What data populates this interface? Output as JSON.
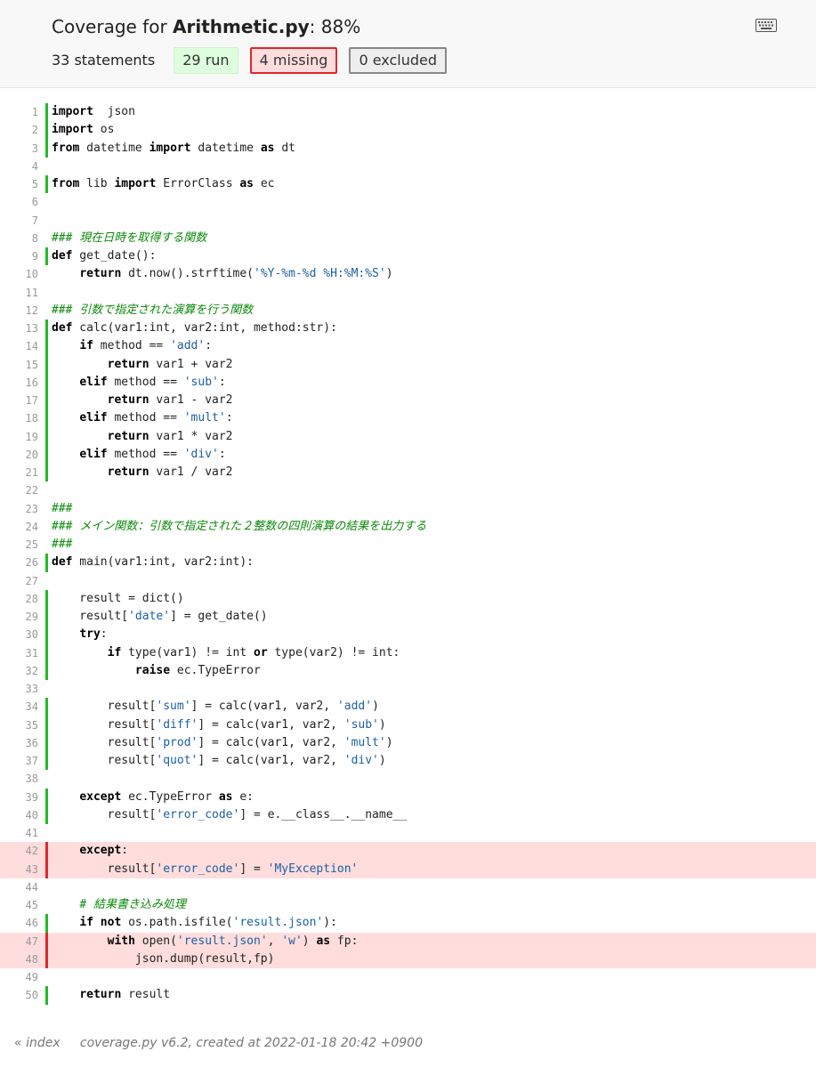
{
  "header": {
    "title_prefix": "Coverage for ",
    "file_name": "Arithmetic.py",
    "title_suffix": ": 88%",
    "statements": "33 statements",
    "run_label": "29 run",
    "missing_label": "4 missing",
    "excluded_label": "0 excluded",
    "keyboard_icon": "keyboard-icon"
  },
  "colors": {
    "run_bar": "#22bb22",
    "missing_bar": "#e0262d",
    "missing_bg": "#ffdddd",
    "run_badge_bg": "#ddffdd",
    "comment": "#0a8a0a",
    "string": "#1d5fa0"
  },
  "lines": [
    {
      "n": "1",
      "status": "run",
      "tokens": [
        [
          "k",
          "import"
        ],
        [
          "",
          "  json"
        ]
      ]
    },
    {
      "n": "2",
      "status": "run",
      "tokens": [
        [
          "k",
          "import"
        ],
        [
          "",
          " os"
        ]
      ]
    },
    {
      "n": "3",
      "status": "run",
      "tokens": [
        [
          "k",
          "from"
        ],
        [
          "",
          " datetime "
        ],
        [
          "k",
          "import"
        ],
        [
          "",
          " datetime "
        ],
        [
          "k",
          "as"
        ],
        [
          "",
          " dt"
        ]
      ]
    },
    {
      "n": "4",
      "status": "",
      "tokens": []
    },
    {
      "n": "5",
      "status": "run",
      "tokens": [
        [
          "k",
          "from"
        ],
        [
          "",
          " lib "
        ],
        [
          "k",
          "import"
        ],
        [
          "",
          " ErrorClass "
        ],
        [
          "k",
          "as"
        ],
        [
          "",
          " ec"
        ]
      ]
    },
    {
      "n": "6",
      "status": "",
      "tokens": []
    },
    {
      "n": "7",
      "status": "",
      "tokens": []
    },
    {
      "n": "8",
      "status": "",
      "tokens": [
        [
          "c",
          "### 現在日時を取得する関数"
        ]
      ]
    },
    {
      "n": "9",
      "status": "run",
      "tokens": [
        [
          "k",
          "def"
        ],
        [
          "",
          " get_date():"
        ]
      ]
    },
    {
      "n": "10",
      "status": "",
      "tokens": [
        [
          "",
          "    "
        ],
        [
          "k",
          "return"
        ],
        [
          "",
          " dt.now().strftime("
        ],
        [
          "s",
          "'%Y-%m-%d %H:%M:%S'"
        ],
        [
          "",
          ")"
        ]
      ]
    },
    {
      "n": "11",
      "status": "",
      "tokens": []
    },
    {
      "n": "12",
      "status": "",
      "tokens": [
        [
          "c",
          "### 引数で指定された演算を行う関数"
        ]
      ]
    },
    {
      "n": "13",
      "status": "run",
      "tokens": [
        [
          "k",
          "def"
        ],
        [
          "",
          " calc(var1:int, var2:int, method:str):"
        ]
      ]
    },
    {
      "n": "14",
      "status": "run",
      "tokens": [
        [
          "",
          "    "
        ],
        [
          "k",
          "if"
        ],
        [
          "",
          " method == "
        ],
        [
          "s",
          "'add'"
        ],
        [
          "",
          ":"
        ]
      ]
    },
    {
      "n": "15",
      "status": "run",
      "tokens": [
        [
          "",
          "        "
        ],
        [
          "k",
          "return"
        ],
        [
          "",
          " var1 + var2"
        ]
      ]
    },
    {
      "n": "16",
      "status": "run",
      "tokens": [
        [
          "",
          "    "
        ],
        [
          "k",
          "elif"
        ],
        [
          "",
          " method == "
        ],
        [
          "s",
          "'sub'"
        ],
        [
          "",
          ":"
        ]
      ]
    },
    {
      "n": "17",
      "status": "run",
      "tokens": [
        [
          "",
          "        "
        ],
        [
          "k",
          "return"
        ],
        [
          "",
          " var1 - var2"
        ]
      ]
    },
    {
      "n": "18",
      "status": "run",
      "tokens": [
        [
          "",
          "    "
        ],
        [
          "k",
          "elif"
        ],
        [
          "",
          " method == "
        ],
        [
          "s",
          "'mult'"
        ],
        [
          "",
          ":"
        ]
      ]
    },
    {
      "n": "19",
      "status": "run",
      "tokens": [
        [
          "",
          "        "
        ],
        [
          "k",
          "return"
        ],
        [
          "",
          " var1 * var2"
        ]
      ]
    },
    {
      "n": "20",
      "status": "run",
      "tokens": [
        [
          "",
          "    "
        ],
        [
          "k",
          "elif"
        ],
        [
          "",
          " method == "
        ],
        [
          "s",
          "'div'"
        ],
        [
          "",
          ":"
        ]
      ]
    },
    {
      "n": "21",
      "status": "run",
      "tokens": [
        [
          "",
          "        "
        ],
        [
          "k",
          "return"
        ],
        [
          "",
          " var1 / var2"
        ]
      ]
    },
    {
      "n": "22",
      "status": "",
      "tokens": []
    },
    {
      "n": "23",
      "status": "",
      "tokens": [
        [
          "c",
          "###"
        ]
      ]
    },
    {
      "n": "24",
      "status": "",
      "tokens": [
        [
          "c",
          "### メイン関数：引数で指定された２整数の四則演算の結果を出力する"
        ]
      ]
    },
    {
      "n": "25",
      "status": "",
      "tokens": [
        [
          "c",
          "###"
        ]
      ]
    },
    {
      "n": "26",
      "status": "run",
      "tokens": [
        [
          "k",
          "def"
        ],
        [
          "",
          " main(var1:int, var2:int):"
        ]
      ]
    },
    {
      "n": "27",
      "status": "",
      "tokens": []
    },
    {
      "n": "28",
      "status": "run",
      "tokens": [
        [
          "",
          "    result = dict()"
        ]
      ]
    },
    {
      "n": "29",
      "status": "run",
      "tokens": [
        [
          "",
          "    result["
        ],
        [
          "s",
          "'date'"
        ],
        [
          "",
          "] = get_date()"
        ]
      ]
    },
    {
      "n": "30",
      "status": "run",
      "tokens": [
        [
          "",
          "    "
        ],
        [
          "k",
          "try"
        ],
        [
          "",
          ":"
        ]
      ]
    },
    {
      "n": "31",
      "status": "run",
      "tokens": [
        [
          "",
          "        "
        ],
        [
          "k",
          "if"
        ],
        [
          "",
          " type(var1) != int "
        ],
        [
          "k",
          "or"
        ],
        [
          "",
          " type(var2) != int:"
        ]
      ]
    },
    {
      "n": "32",
      "status": "run",
      "tokens": [
        [
          "",
          "            "
        ],
        [
          "k",
          "raise"
        ],
        [
          "",
          " ec.TypeError"
        ]
      ]
    },
    {
      "n": "33",
      "status": "",
      "tokens": []
    },
    {
      "n": "34",
      "status": "run",
      "tokens": [
        [
          "",
          "        result["
        ],
        [
          "s",
          "'sum'"
        ],
        [
          "",
          "] = calc(var1, var2, "
        ],
        [
          "s",
          "'add'"
        ],
        [
          "",
          ")"
        ]
      ]
    },
    {
      "n": "35",
      "status": "run",
      "tokens": [
        [
          "",
          "        result["
        ],
        [
          "s",
          "'diff'"
        ],
        [
          "",
          "] = calc(var1, var2, "
        ],
        [
          "s",
          "'sub'"
        ],
        [
          "",
          ")"
        ]
      ]
    },
    {
      "n": "36",
      "status": "run",
      "tokens": [
        [
          "",
          "        result["
        ],
        [
          "s",
          "'prod'"
        ],
        [
          "",
          "] = calc(var1, var2, "
        ],
        [
          "s",
          "'mult'"
        ],
        [
          "",
          ")"
        ]
      ]
    },
    {
      "n": "37",
      "status": "run",
      "tokens": [
        [
          "",
          "        result["
        ],
        [
          "s",
          "'quot'"
        ],
        [
          "",
          "] = calc(var1, var2, "
        ],
        [
          "s",
          "'div'"
        ],
        [
          "",
          ")"
        ]
      ]
    },
    {
      "n": "38",
      "status": "",
      "tokens": []
    },
    {
      "n": "39",
      "status": "run",
      "tokens": [
        [
          "",
          "    "
        ],
        [
          "k",
          "except"
        ],
        [
          "",
          " ec.TypeError "
        ],
        [
          "k",
          "as"
        ],
        [
          "",
          " e:"
        ]
      ]
    },
    {
      "n": "40",
      "status": "run",
      "tokens": [
        [
          "",
          "        result["
        ],
        [
          "s",
          "'error_code'"
        ],
        [
          "",
          "] = e.__class__.__name__"
        ]
      ]
    },
    {
      "n": "41",
      "status": "",
      "tokens": []
    },
    {
      "n": "42",
      "status": "mis",
      "tokens": [
        [
          "",
          "    "
        ],
        [
          "k",
          "except"
        ],
        [
          "",
          ":"
        ]
      ]
    },
    {
      "n": "43",
      "status": "mis",
      "tokens": [
        [
          "",
          "        result["
        ],
        [
          "s",
          "'error_code'"
        ],
        [
          "",
          "] = "
        ],
        [
          "s",
          "'MyException'"
        ]
      ]
    },
    {
      "n": "44",
      "status": "",
      "tokens": []
    },
    {
      "n": "45",
      "status": "",
      "tokens": [
        [
          "",
          "    "
        ],
        [
          "c",
          "# 結果書き込み処理"
        ]
      ]
    },
    {
      "n": "46",
      "status": "run",
      "tokens": [
        [
          "",
          "    "
        ],
        [
          "k",
          "if"
        ],
        [
          "",
          " "
        ],
        [
          "k",
          "not"
        ],
        [
          "",
          " os.path.isfile("
        ],
        [
          "s",
          "'result.json'"
        ],
        [
          "",
          "):"
        ]
      ]
    },
    {
      "n": "47",
      "status": "mis",
      "tokens": [
        [
          "",
          "        "
        ],
        [
          "k",
          "with"
        ],
        [
          "",
          " open("
        ],
        [
          "s",
          "'result.json'"
        ],
        [
          "",
          ", "
        ],
        [
          "s",
          "'w'"
        ],
        [
          "",
          ") "
        ],
        [
          "k",
          "as"
        ],
        [
          "",
          " fp:"
        ]
      ]
    },
    {
      "n": "48",
      "status": "mis",
      "tokens": [
        [
          "",
          "            json.dump(result,fp)"
        ]
      ]
    },
    {
      "n": "49",
      "status": "",
      "tokens": []
    },
    {
      "n": "50",
      "status": "run",
      "tokens": [
        [
          "",
          "    "
        ],
        [
          "k",
          "return"
        ],
        [
          "",
          " result"
        ]
      ]
    }
  ],
  "footer": {
    "index_link": "« index",
    "created": "coverage.py v6.2, created at 2022-01-18 20:42 +0900"
  }
}
